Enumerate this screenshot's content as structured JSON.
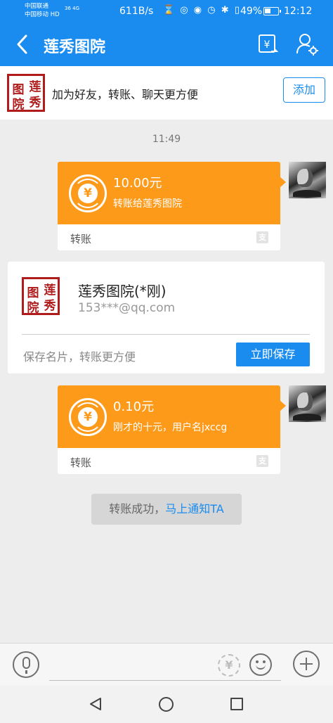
{
  "status_bar": {
    "carrier1": "中国联通",
    "carrier2": "中国移动 HD",
    "network": "36 4G",
    "speed": "611B/s",
    "battery": "49%",
    "time": "12:12"
  },
  "nav": {
    "title": "莲秀图院",
    "back_icon": "chevron-left-icon",
    "transfer_icon": "yuan-transfer-icon",
    "profile_icon": "user-settings-icon"
  },
  "banner": {
    "seal_chars": [
      "莲",
      "图",
      "秀",
      "院"
    ],
    "text": "加为好友，转账、聊天更方便",
    "add_label": "添加"
  },
  "chat": {
    "timestamp": "11:49",
    "transfers": [
      {
        "amount": "10.00元",
        "note": "转账给莲秀图院",
        "label": "转账"
      },
      {
        "amount": "0.10元",
        "note": "刚才的十元，用户名jxccg",
        "label": "转账"
      }
    ],
    "contact_card": {
      "seal_chars": [
        "莲",
        "图",
        "秀",
        "院"
      ],
      "name": "莲秀图院(*刚)",
      "email": "153***@qq.com",
      "hint": "保存名片，转账更方便",
      "save_label": "立即保存"
    },
    "system_tip": {
      "text": "转账成功，",
      "link": "马上通知TA"
    }
  },
  "input_bar": {
    "yuan_symbol": "¥",
    "icons": [
      "microphone-icon",
      "yuan-icon",
      "emoji-icon",
      "plus-icon"
    ]
  },
  "colors": {
    "primary": "#1a8cf0",
    "transfer_orange": "#fd9a1a",
    "seal_red": "#b01c1c",
    "chat_bg": "#ededed"
  }
}
